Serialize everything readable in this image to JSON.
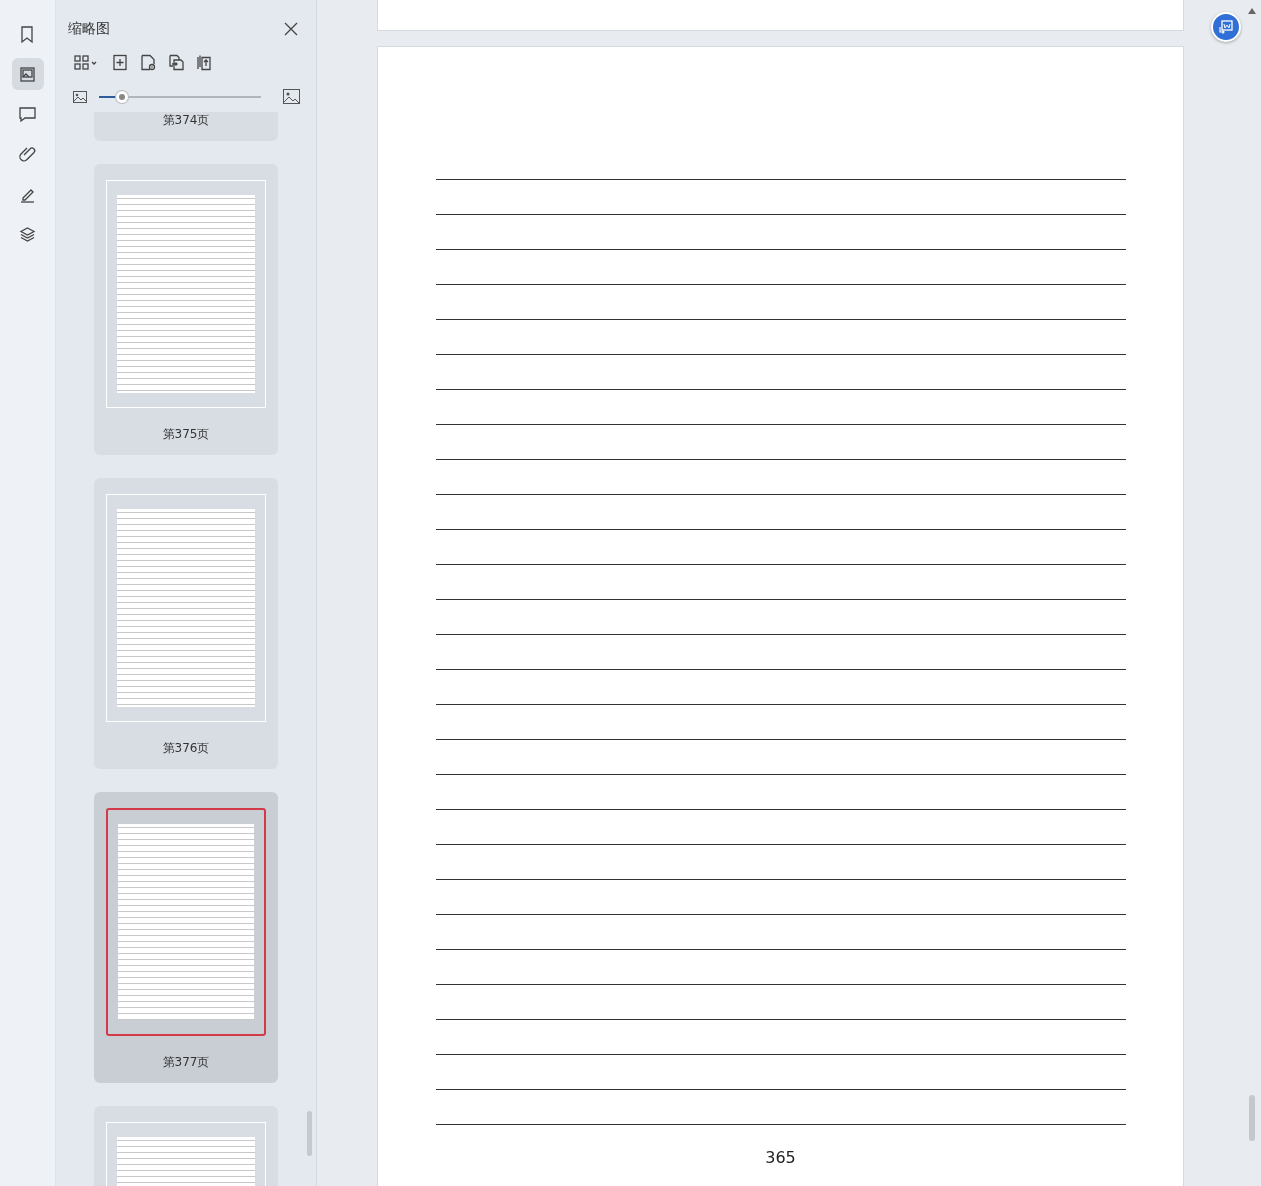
{
  "rail": {
    "items": [
      {
        "kind": "bookmark",
        "selected": false
      },
      {
        "kind": "thumbnails",
        "selected": true
      },
      {
        "kind": "comment",
        "selected": false
      },
      {
        "kind": "attachment",
        "selected": false
      },
      {
        "kind": "signature",
        "selected": false
      },
      {
        "kind": "layers",
        "selected": false
      }
    ]
  },
  "sidebar": {
    "title": "缩略图",
    "toolbar": [
      {
        "kind": "grid-menu"
      },
      {
        "kind": "add-page"
      },
      {
        "kind": "page-settings"
      },
      {
        "kind": "replace-page"
      },
      {
        "kind": "extract-page"
      }
    ],
    "size_slider": {
      "level": 0.14
    },
    "thumbnails": [
      {
        "label": "第374页",
        "selected": false
      },
      {
        "label": "第375页",
        "selected": false
      },
      {
        "label": "第376页",
        "selected": false
      },
      {
        "label": "第377页",
        "selected": true
      },
      {
        "selected": false
      }
    ]
  },
  "document": {
    "page_number": "365"
  }
}
